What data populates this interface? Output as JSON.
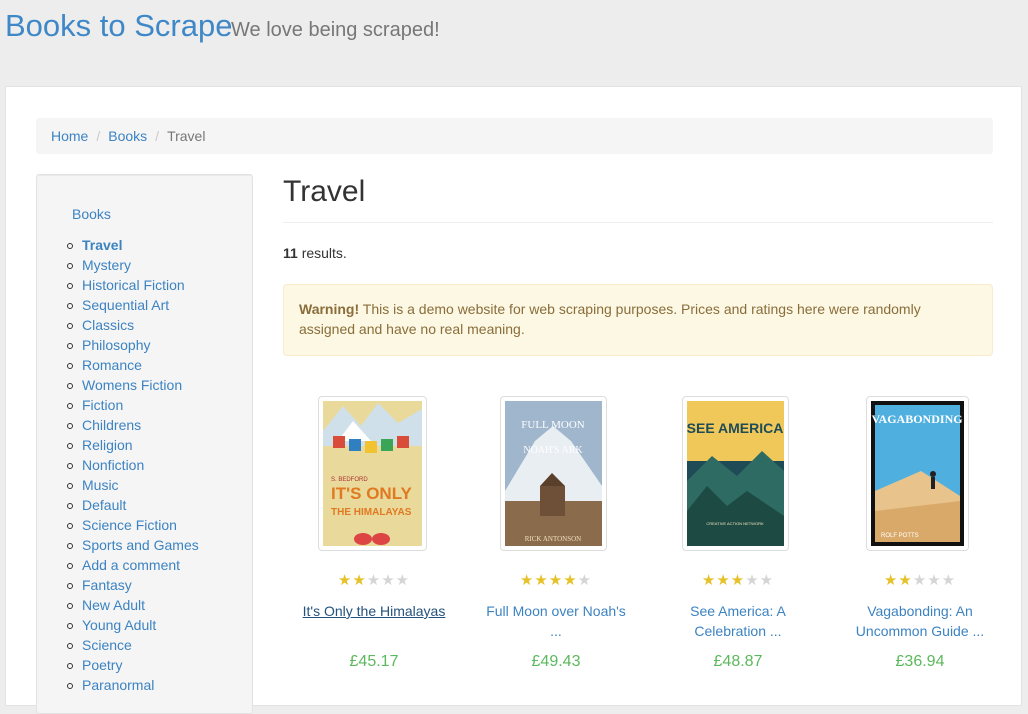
{
  "header": {
    "brand": "Books to Scrape",
    "tagline": "We love being scraped!"
  },
  "breadcrumb": {
    "home": "Home",
    "books": "Books",
    "current": "Travel"
  },
  "sidebar": {
    "root": "Books",
    "items": [
      "Travel",
      "Mystery",
      "Historical Fiction",
      "Sequential Art",
      "Classics",
      "Philosophy",
      "Romance",
      "Womens Fiction",
      "Fiction",
      "Childrens",
      "Religion",
      "Nonfiction",
      "Music",
      "Default",
      "Science Fiction",
      "Sports and Games",
      "Add a comment",
      "Fantasy",
      "New Adult",
      "Young Adult",
      "Science",
      "Poetry",
      "Paranormal"
    ]
  },
  "page": {
    "title": "Travel",
    "results_count": "11",
    "results_suffix": " results.",
    "warning_label": "Warning!",
    "warning_text": " This is a demo website for web scraping purposes. Prices and ratings here were randomly assigned and have no real meaning."
  },
  "products": [
    {
      "title_line1": "It's Only the Himalayas",
      "title_line2": "",
      "price": "£45.17",
      "rating": 2,
      "cover": {
        "text1": "S. BEDFORD",
        "text2": "IT'S ONLY",
        "text3": "THE HIMALAYAS"
      }
    },
    {
      "title_line1": "Full Moon over Noah's",
      "title_line2": "...",
      "price": "£49.43",
      "rating": 4,
      "cover": {
        "text1": "FULL MOON",
        "text2": "NOAH'S ARK",
        "text3": "RICK ANTONSON"
      }
    },
    {
      "title_line1": "See America: A",
      "title_line2": "Celebration ...",
      "price": "£48.87",
      "rating": 3,
      "cover": {
        "text1": "SEE AMERICA",
        "text2": "",
        "text3": "CREATIVE ACTION NETWORK"
      }
    },
    {
      "title_line1": "Vagabonding: An",
      "title_line2": "Uncommon Guide ...",
      "price": "£36.94",
      "rating": 2,
      "cover": {
        "text1": "VAGABONDING",
        "text2": "",
        "text3": "ROLF POTTS"
      }
    }
  ],
  "colors": {
    "link": "#3c83c2",
    "price": "#5cb85c",
    "star_on": "#e6c229",
    "star_off": "#d5d5d5"
  }
}
